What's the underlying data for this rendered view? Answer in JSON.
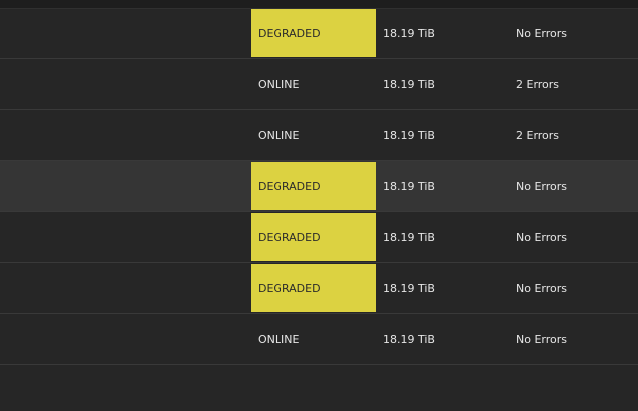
{
  "pool_table": {
    "rows": [
      {
        "name": "",
        "status": "DEGRADED",
        "size": "18.19 TiB",
        "errors": "No Errors"
      },
      {
        "name": "",
        "status": "ONLINE",
        "size": "18.19 TiB",
        "errors": "2 Errors"
      },
      {
        "name": "",
        "status": "ONLINE",
        "size": "18.19 TiB",
        "errors": "2 Errors"
      },
      {
        "name": "",
        "status": "DEGRADED",
        "size": "18.19 TiB",
        "errors": "No Errors"
      },
      {
        "name": "",
        "status": "DEGRADED",
        "size": "18.19 TiB",
        "errors": "No Errors"
      },
      {
        "name": "",
        "status": "DEGRADED",
        "size": "18.19 TiB",
        "errors": "No Errors"
      },
      {
        "name": "",
        "status": "ONLINE",
        "size": "18.19 TiB",
        "errors": "No Errors"
      }
    ]
  },
  "colors": {
    "background": "#262626",
    "row_hover": "#353535",
    "degraded": "#dcd241",
    "text": "#e6e6e6"
  }
}
